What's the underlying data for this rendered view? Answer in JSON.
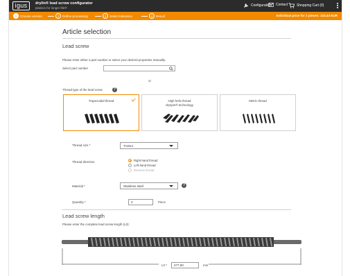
{
  "header": {
    "logo": "igus",
    "app_title": "drylin® lead screw configurator",
    "app_subtitle": "plastics for longer life®",
    "nav": [
      {
        "label": "Configuration",
        "icon": "wrench-icon"
      },
      {
        "label": "Contact",
        "icon": "mail-icon"
      },
      {
        "label": "Shopping Cart (0)",
        "icon": "cart-icon"
      }
    ],
    "menu_icon": "kebab-menu-icon"
  },
  "steps": [
    {
      "num": "1",
      "label": "Choose version",
      "active": true
    },
    {
      "num": "2",
      "label": "Define processing",
      "active": false
    },
    {
      "num": "3",
      "label": "Select tolerance",
      "active": false
    },
    {
      "num": "4",
      "label": "Result",
      "active": false
    }
  ],
  "price": "Individual price for 2 pieces: 133,43 EUR",
  "main": {
    "title": "Article selection",
    "lead_screw": {
      "heading": "Lead screw",
      "instruction": "Please enter either a part number or select your desired properties manually.",
      "part_number_label": "Select part number",
      "part_number_value": "",
      "or_label": "or",
      "thread_type_label": "Thread type of the lead screw",
      "thread_types": [
        {
          "title": "Trapezoidal thread",
          "subtitle": "",
          "selected": true
        },
        {
          "title": "High helix thread",
          "subtitle": "dryspin® technology",
          "selected": false
        },
        {
          "title": "Metric thread",
          "subtitle": "",
          "selected": false
        }
      ],
      "thread_size_label": "Thread size *",
      "thread_size_value": "Tr10x4",
      "thread_direction_label": "Thread direction",
      "thread_directions": [
        {
          "label": "Right-hand thread",
          "selected": true,
          "disabled": false
        },
        {
          "label": "Left-hand thread",
          "selected": false,
          "disabled": false
        },
        {
          "label": "Reverse thread",
          "selected": false,
          "disabled": true
        }
      ],
      "material_label": "Material *",
      "material_value": "Stainless steel",
      "quantity_label": "Quantity *",
      "quantity_value": "2",
      "quantity_unit": "Piece"
    },
    "length": {
      "heading": "Lead screw length",
      "instruction": "Please enter the complete lead screw length (L0):",
      "l0_label": "L0 *",
      "l0_value": "477,00",
      "unit": "mm"
    }
  },
  "colors": {
    "accent": "#f18a00",
    "header_bg": "#2b2b2b"
  }
}
